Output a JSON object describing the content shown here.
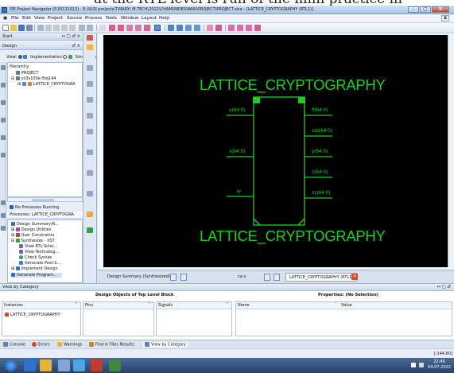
{
  "caption_fragment": "at the  RTL level is  run of the  mini practice in",
  "window": {
    "title": "ISE Project Navigator (P.20131013) - E:\\VLSI projects\\T.MARY\\ M.TECH\\2022\\CHAMUNDESWARI\\PROJECT\\PROJECT.xise - [LATTICE_CRYPTOGRAPHY (RTL1)]",
    "minimize": "–",
    "maximize": "□",
    "close": "X"
  },
  "menu": [
    "File",
    "Edit",
    "View",
    "Project",
    "Source",
    "Process",
    "Tools",
    "Window",
    "Layout",
    "Help"
  ],
  "start_pane": {
    "label": "Start",
    "controls": "↔ □ ♂ ✕"
  },
  "design_pane": {
    "label": "Design",
    "controls": "♂ ✕",
    "view_label": "View:",
    "view_impl": "Implementation",
    "view_sim": "Simulation",
    "hierarchy_label": "Hierarchy",
    "tree": [
      "PROJECT",
      "xc3s100e-5tq144",
      "LATTICE_CRYPTOGRA"
    ],
    "no_processes": "No Processes Running",
    "processes_label": "Processes: LATTICE_CRYPTOGRA",
    "process_items": [
      "Design Summary/R...",
      "Design Utilities",
      "User Constraints",
      "Synthesize - XST",
      "View RTL Sche...",
      "View Technolog...",
      "Check Syntax",
      "Generate Post-S...",
      "Implement Design",
      "Generate Program..."
    ]
  },
  "schematic": {
    "top_label": "LATTICE_CRYPTOGRAPHY",
    "bottom_label": "LATTICE_CRYPTOGRAPHY",
    "inputs": [
      "u(64:0)",
      "v(64:0)",
      "w"
    ],
    "outputs": [
      "ff(64:0)",
      "out(64:0)",
      "y(64:0)",
      "z(64:0)",
      "zz(64:0)"
    ],
    "colors": {
      "background": "#000000",
      "lines": "#19d11d"
    }
  },
  "doc_tabs": {
    "design_summary": "Design Summary (Synthesized)",
    "placeholder": "ca.v",
    "rtl": "LATTICE_CRYPTOGRAPHY (RTL1)"
  },
  "view_by_category": {
    "label": "View by Category",
    "controls": "↔ □ ♂",
    "design_objects": "Design Objects of Top Level Block",
    "properties": "Properties: (No Selection)",
    "columns": {
      "instances": "Instances",
      "pins": "Pins",
      "signals": "Signals",
      "name": "Name",
      "value": "Value"
    },
    "instance_row": "LATTICE_CRYPTOGRAPHY"
  },
  "bottom_tabs": [
    "Console",
    "Errors",
    "Warnings",
    "Find in Files Results",
    "View by Category"
  ],
  "status": {
    "coords": "[-144,60]"
  },
  "tray": {
    "time": "22:46",
    "date": "04-07-2022",
    "lang": "▲ ◐"
  }
}
